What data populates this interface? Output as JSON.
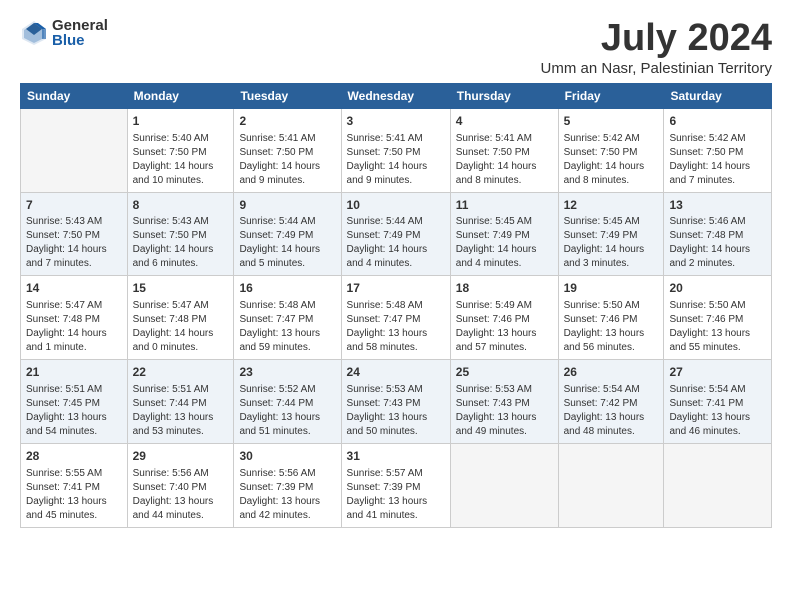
{
  "logo": {
    "general": "General",
    "blue": "Blue"
  },
  "title": "July 2024",
  "location": "Umm an Nasr, Palestinian Territory",
  "headers": [
    "Sunday",
    "Monday",
    "Tuesday",
    "Wednesday",
    "Thursday",
    "Friday",
    "Saturday"
  ],
  "weeks": [
    [
      {
        "num": "",
        "lines": []
      },
      {
        "num": "1",
        "lines": [
          "Sunrise: 5:40 AM",
          "Sunset: 7:50 PM",
          "Daylight: 14 hours",
          "and 10 minutes."
        ]
      },
      {
        "num": "2",
        "lines": [
          "Sunrise: 5:41 AM",
          "Sunset: 7:50 PM",
          "Daylight: 14 hours",
          "and 9 minutes."
        ]
      },
      {
        "num": "3",
        "lines": [
          "Sunrise: 5:41 AM",
          "Sunset: 7:50 PM",
          "Daylight: 14 hours",
          "and 9 minutes."
        ]
      },
      {
        "num": "4",
        "lines": [
          "Sunrise: 5:41 AM",
          "Sunset: 7:50 PM",
          "Daylight: 14 hours",
          "and 8 minutes."
        ]
      },
      {
        "num": "5",
        "lines": [
          "Sunrise: 5:42 AM",
          "Sunset: 7:50 PM",
          "Daylight: 14 hours",
          "and 8 minutes."
        ]
      },
      {
        "num": "6",
        "lines": [
          "Sunrise: 5:42 AM",
          "Sunset: 7:50 PM",
          "Daylight: 14 hours",
          "and 7 minutes."
        ]
      }
    ],
    [
      {
        "num": "7",
        "lines": [
          "Sunrise: 5:43 AM",
          "Sunset: 7:50 PM",
          "Daylight: 14 hours",
          "and 7 minutes."
        ]
      },
      {
        "num": "8",
        "lines": [
          "Sunrise: 5:43 AM",
          "Sunset: 7:50 PM",
          "Daylight: 14 hours",
          "and 6 minutes."
        ]
      },
      {
        "num": "9",
        "lines": [
          "Sunrise: 5:44 AM",
          "Sunset: 7:49 PM",
          "Daylight: 14 hours",
          "and 5 minutes."
        ]
      },
      {
        "num": "10",
        "lines": [
          "Sunrise: 5:44 AM",
          "Sunset: 7:49 PM",
          "Daylight: 14 hours",
          "and 4 minutes."
        ]
      },
      {
        "num": "11",
        "lines": [
          "Sunrise: 5:45 AM",
          "Sunset: 7:49 PM",
          "Daylight: 14 hours",
          "and 4 minutes."
        ]
      },
      {
        "num": "12",
        "lines": [
          "Sunrise: 5:45 AM",
          "Sunset: 7:49 PM",
          "Daylight: 14 hours",
          "and 3 minutes."
        ]
      },
      {
        "num": "13",
        "lines": [
          "Sunrise: 5:46 AM",
          "Sunset: 7:48 PM",
          "Daylight: 14 hours",
          "and 2 minutes."
        ]
      }
    ],
    [
      {
        "num": "14",
        "lines": [
          "Sunrise: 5:47 AM",
          "Sunset: 7:48 PM",
          "Daylight: 14 hours",
          "and 1 minute."
        ]
      },
      {
        "num": "15",
        "lines": [
          "Sunrise: 5:47 AM",
          "Sunset: 7:48 PM",
          "Daylight: 14 hours",
          "and 0 minutes."
        ]
      },
      {
        "num": "16",
        "lines": [
          "Sunrise: 5:48 AM",
          "Sunset: 7:47 PM",
          "Daylight: 13 hours",
          "and 59 minutes."
        ]
      },
      {
        "num": "17",
        "lines": [
          "Sunrise: 5:48 AM",
          "Sunset: 7:47 PM",
          "Daylight: 13 hours",
          "and 58 minutes."
        ]
      },
      {
        "num": "18",
        "lines": [
          "Sunrise: 5:49 AM",
          "Sunset: 7:46 PM",
          "Daylight: 13 hours",
          "and 57 minutes."
        ]
      },
      {
        "num": "19",
        "lines": [
          "Sunrise: 5:50 AM",
          "Sunset: 7:46 PM",
          "Daylight: 13 hours",
          "and 56 minutes."
        ]
      },
      {
        "num": "20",
        "lines": [
          "Sunrise: 5:50 AM",
          "Sunset: 7:46 PM",
          "Daylight: 13 hours",
          "and 55 minutes."
        ]
      }
    ],
    [
      {
        "num": "21",
        "lines": [
          "Sunrise: 5:51 AM",
          "Sunset: 7:45 PM",
          "Daylight: 13 hours",
          "and 54 minutes."
        ]
      },
      {
        "num": "22",
        "lines": [
          "Sunrise: 5:51 AM",
          "Sunset: 7:44 PM",
          "Daylight: 13 hours",
          "and 53 minutes."
        ]
      },
      {
        "num": "23",
        "lines": [
          "Sunrise: 5:52 AM",
          "Sunset: 7:44 PM",
          "Daylight: 13 hours",
          "and 51 minutes."
        ]
      },
      {
        "num": "24",
        "lines": [
          "Sunrise: 5:53 AM",
          "Sunset: 7:43 PM",
          "Daylight: 13 hours",
          "and 50 minutes."
        ]
      },
      {
        "num": "25",
        "lines": [
          "Sunrise: 5:53 AM",
          "Sunset: 7:43 PM",
          "Daylight: 13 hours",
          "and 49 minutes."
        ]
      },
      {
        "num": "26",
        "lines": [
          "Sunrise: 5:54 AM",
          "Sunset: 7:42 PM",
          "Daylight: 13 hours",
          "and 48 minutes."
        ]
      },
      {
        "num": "27",
        "lines": [
          "Sunrise: 5:54 AM",
          "Sunset: 7:41 PM",
          "Daylight: 13 hours",
          "and 46 minutes."
        ]
      }
    ],
    [
      {
        "num": "28",
        "lines": [
          "Sunrise: 5:55 AM",
          "Sunset: 7:41 PM",
          "Daylight: 13 hours",
          "and 45 minutes."
        ]
      },
      {
        "num": "29",
        "lines": [
          "Sunrise: 5:56 AM",
          "Sunset: 7:40 PM",
          "Daylight: 13 hours",
          "and 44 minutes."
        ]
      },
      {
        "num": "30",
        "lines": [
          "Sunrise: 5:56 AM",
          "Sunset: 7:39 PM",
          "Daylight: 13 hours",
          "and 42 minutes."
        ]
      },
      {
        "num": "31",
        "lines": [
          "Sunrise: 5:57 AM",
          "Sunset: 7:39 PM",
          "Daylight: 13 hours",
          "and 41 minutes."
        ]
      },
      {
        "num": "",
        "lines": []
      },
      {
        "num": "",
        "lines": []
      },
      {
        "num": "",
        "lines": []
      }
    ]
  ]
}
